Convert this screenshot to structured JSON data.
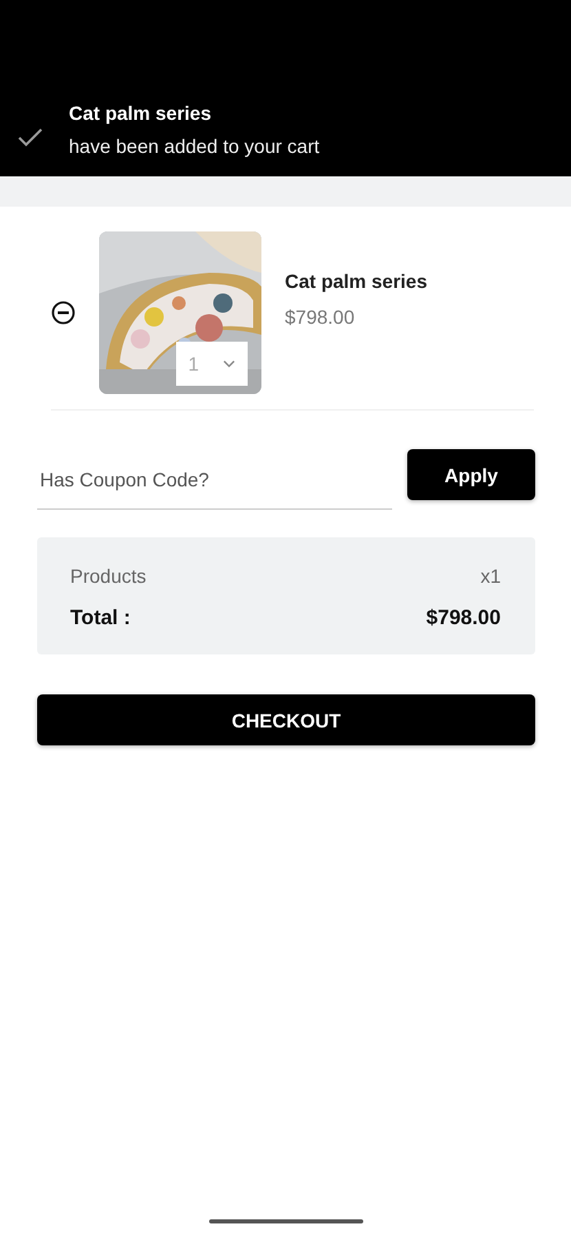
{
  "toast": {
    "title": "Cat palm series",
    "message": "have been added to your cart"
  },
  "cart_items": [
    {
      "name": "Cat palm series",
      "price": "$798.00",
      "quantity": "1"
    }
  ],
  "coupon": {
    "placeholder": "Has Coupon Code?",
    "button": "Apply"
  },
  "summary": {
    "products_label": "Products",
    "products_count": "x1",
    "total_label": "Total :",
    "total_value": "$798.00"
  },
  "checkout_button": "CHECKOUT"
}
